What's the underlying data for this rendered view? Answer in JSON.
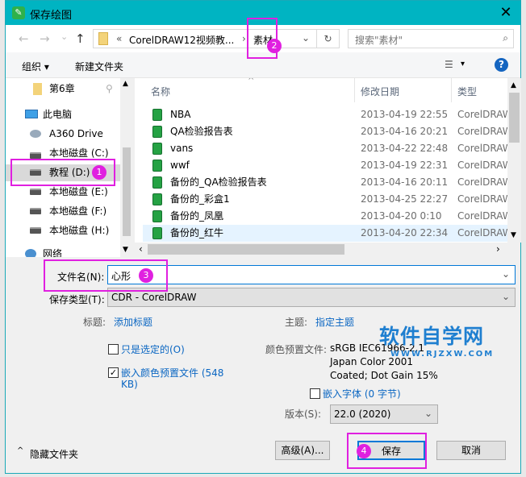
{
  "window": {
    "title": "保存绘图",
    "close": "✕"
  },
  "nav": {
    "back": "←",
    "forward": "→",
    "recent": "⌄",
    "up": "↑",
    "path_prefix": "«",
    "path_parent": "CorelDRAW12视频教...",
    "sep": "›",
    "path_current": "素材",
    "refresh": "↻",
    "search_placeholder": "搜索\"素材\""
  },
  "toolbar": {
    "organize": "组织 ▾",
    "new_folder": "新建文件夹",
    "view": "▾",
    "help": "?"
  },
  "navpane": {
    "items": [
      {
        "label": "第6章"
      },
      {
        "label": "此电脑"
      },
      {
        "label": "A360 Drive"
      },
      {
        "label": "本地磁盘 (C:)"
      },
      {
        "label": "教程 (D:)"
      },
      {
        "label": "本地磁盘 (E:)"
      },
      {
        "label": "本地磁盘 (F:)"
      },
      {
        "label": "本地磁盘 (H:)"
      },
      {
        "label": "网络"
      }
    ]
  },
  "filelist": {
    "columns": {
      "name": "名称",
      "date": "修改日期",
      "type": "类型"
    },
    "rows": [
      {
        "name": "NBA",
        "date": "2013-04-19 22:55",
        "type": "CorelDRAW"
      },
      {
        "name": "QA检验报告表",
        "date": "2013-04-16 20:21",
        "type": "CorelDRAW"
      },
      {
        "name": "vans",
        "date": "2013-04-22 22:48",
        "type": "CorelDRAW"
      },
      {
        "name": "wwf",
        "date": "2013-04-19 22:31",
        "type": "CorelDRAW"
      },
      {
        "name": "备份的_QA检验报告表",
        "date": "2013-04-16 20:11",
        "type": "CorelDRAW"
      },
      {
        "name": "备份的_彩盒1",
        "date": "2013-04-25 22:27",
        "type": "CorelDRAW"
      },
      {
        "name": "备份的_凤凰",
        "date": "2013-04-20 0:10",
        "type": "CorelDRAW"
      },
      {
        "name": "备份的_红牛",
        "date": "2013-04-20 22:34",
        "type": "CorelDRAW"
      }
    ]
  },
  "form": {
    "filename_label": "文件名(N):",
    "filename_value": "心形",
    "filetype_label": "保存类型(T):",
    "filetype_value": "CDR - CorelDRAW",
    "title_label": "标题:",
    "title_link": "添加标题",
    "subject_label": "主题:",
    "subject_link": "指定主题",
    "selected_only": "只是选定的(O)",
    "embed_profile": "嵌入颜色预置文件 (548",
    "embed_profile_2": "KB)",
    "profile_label": "颜色预置文件:",
    "profile_1": "sRGB IEC61966-2.1",
    "profile_2": "Japan Color 2001",
    "profile_3": "Coated; Dot Gain 15%",
    "embed_fonts": "嵌入字体 (0 字节)",
    "version_label": "版本(S):",
    "version_value": "22.0 (2020)"
  },
  "footer": {
    "hide_folders": "隐藏文件夹",
    "advanced": "高级(A)...",
    "save": "保存",
    "cancel": "取消"
  },
  "annotations": {
    "b1": "1",
    "b2": "2",
    "b3": "3",
    "b4": "4"
  },
  "watermark": {
    "main": "软件自学网",
    "sub": "WWW.RJZXW.COM"
  }
}
